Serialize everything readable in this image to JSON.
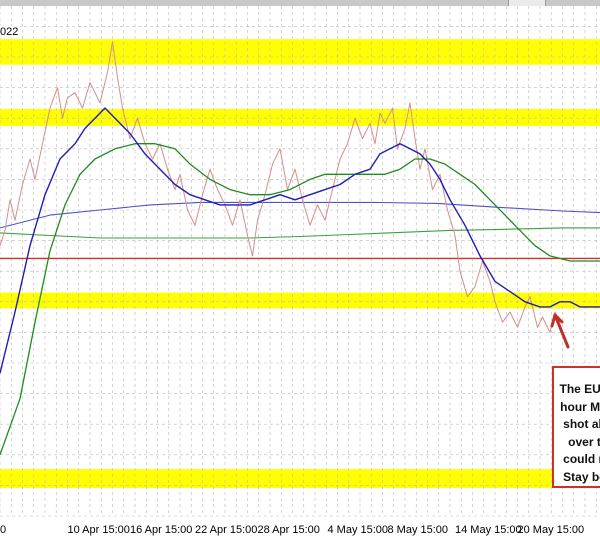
{
  "date_fragment": "022",
  "annotation_lines": [
    "The EUR",
    "hour MA",
    "shot ab",
    "over t",
    "could n",
    "Stay be"
  ],
  "colors": {
    "background": "#ffffff",
    "grid": "#b9b9b9",
    "highlight": "#ffff00",
    "price": "#d88c8c",
    "ma_blue": "#1e1eb4",
    "ma_green": "#1e8c1e",
    "ma_long_blue": "#5050c8",
    "ma_long_green": "#3ca03c",
    "red_level": "#d0302a",
    "annotation_border": "#d0302a",
    "arrow": "#c0302a"
  },
  "chart_data": {
    "type": "line",
    "title": "",
    "xlabel": "",
    "ylabel": "",
    "x_tick_labels": [
      "0",
      "10 Apr 15:00",
      "16 Apr 15:00",
      "22 Apr 15:00",
      "28 Apr 15:00",
      "4 May 15:00",
      "8 May 15:00",
      "14 May 15:00",
      "20 May 15:00"
    ],
    "x_ticks": [
      0,
      27,
      52,
      78,
      103,
      131,
      155,
      182,
      207
    ],
    "xlim": [
      0,
      240
    ],
    "ylim": [
      0,
      100
    ],
    "highlight_zones": [
      [
        88.5,
        93.5
      ],
      [
        76.5,
        79.8
      ],
      [
        40.7,
        43.8
      ],
      [
        5.5,
        9.2
      ]
    ],
    "horizontal_levels": [
      {
        "name": "red",
        "value": 50.5
      }
    ],
    "series": [
      {
        "key": "price",
        "points": [
          [
            0,
            53
          ],
          [
            2,
            56
          ],
          [
            4,
            62
          ],
          [
            6,
            58
          ],
          [
            9,
            65
          ],
          [
            12,
            70
          ],
          [
            14,
            66
          ],
          [
            17,
            73
          ],
          [
            20,
            80
          ],
          [
            23,
            84
          ],
          [
            25,
            78
          ],
          [
            27,
            82
          ],
          [
            30,
            83
          ],
          [
            33,
            80
          ],
          [
            36,
            85
          ],
          [
            38,
            83
          ],
          [
            40,
            81
          ],
          [
            43,
            87
          ],
          [
            45,
            93
          ],
          [
            47,
            86
          ],
          [
            49,
            80
          ],
          [
            52,
            74
          ],
          [
            55,
            78
          ],
          [
            58,
            73
          ],
          [
            61,
            70
          ],
          [
            64,
            73
          ],
          [
            67,
            68
          ],
          [
            70,
            64
          ],
          [
            72,
            67
          ],
          [
            75,
            60
          ],
          [
            78,
            57
          ],
          [
            81,
            63
          ],
          [
            84,
            68
          ],
          [
            87,
            64
          ],
          [
            90,
            61
          ],
          [
            93,
            57
          ],
          [
            96,
            62
          ],
          [
            99,
            55
          ],
          [
            101,
            51
          ],
          [
            103,
            58
          ],
          [
            106,
            63
          ],
          [
            109,
            69
          ],
          [
            112,
            72
          ],
          [
            115,
            64
          ],
          [
            118,
            68
          ],
          [
            121,
            62
          ],
          [
            124,
            57
          ],
          [
            127,
            61
          ],
          [
            130,
            58
          ],
          [
            133,
            64
          ],
          [
            136,
            70
          ],
          [
            139,
            73
          ],
          [
            142,
            78
          ],
          [
            145,
            74
          ],
          [
            148,
            77
          ],
          [
            150,
            73
          ],
          [
            152,
            79
          ],
          [
            154,
            77
          ],
          [
            157,
            80
          ],
          [
            159,
            72
          ],
          [
            162,
            76
          ],
          [
            164,
            81
          ],
          [
            166,
            74
          ],
          [
            168,
            68
          ],
          [
            170,
            72
          ],
          [
            173,
            64
          ],
          [
            176,
            67
          ],
          [
            179,
            60
          ],
          [
            182,
            55
          ],
          [
            184,
            48
          ],
          [
            187,
            43
          ],
          [
            190,
            45
          ],
          [
            193,
            50
          ],
          [
            196,
            46
          ],
          [
            198,
            42
          ],
          [
            201,
            38
          ],
          [
            204,
            40
          ],
          [
            207,
            37
          ],
          [
            210,
            41
          ],
          [
            212,
            43
          ],
          [
            215,
            37
          ],
          [
            217,
            39
          ],
          [
            220,
            36
          ],
          [
            222,
            40
          ],
          [
            224,
            38
          ]
        ]
      },
      {
        "key": "ma_blue",
        "points": [
          [
            0,
            28
          ],
          [
            6,
            40
          ],
          [
            12,
            53
          ],
          [
            18,
            63
          ],
          [
            24,
            70
          ],
          [
            30,
            73
          ],
          [
            34,
            76
          ],
          [
            38,
            78
          ],
          [
            42,
            80
          ],
          [
            46,
            78
          ],
          [
            52,
            75
          ],
          [
            58,
            71
          ],
          [
            64,
            68
          ],
          [
            70,
            65
          ],
          [
            76,
            63
          ],
          [
            82,
            62
          ],
          [
            88,
            61
          ],
          [
            94,
            61
          ],
          [
            100,
            61
          ],
          [
            106,
            62
          ],
          [
            112,
            63
          ],
          [
            118,
            62
          ],
          [
            124,
            63
          ],
          [
            130,
            64
          ],
          [
            136,
            65
          ],
          [
            142,
            67
          ],
          [
            148,
            68
          ],
          [
            152,
            71
          ],
          [
            156,
            72
          ],
          [
            160,
            73
          ],
          [
            164,
            72
          ],
          [
            168,
            71
          ],
          [
            172,
            69
          ],
          [
            176,
            66
          ],
          [
            180,
            62
          ],
          [
            186,
            57
          ],
          [
            192,
            51
          ],
          [
            198,
            46
          ],
          [
            204,
            44
          ],
          [
            210,
            42
          ],
          [
            216,
            41
          ],
          [
            220,
            41
          ],
          [
            224,
            42
          ],
          [
            228,
            42
          ],
          [
            232,
            41
          ],
          [
            240,
            41
          ]
        ]
      },
      {
        "key": "ma_green",
        "points": [
          [
            0,
            12
          ],
          [
            8,
            23
          ],
          [
            14,
            38
          ],
          [
            20,
            52
          ],
          [
            26,
            61
          ],
          [
            32,
            67
          ],
          [
            38,
            70
          ],
          [
            46,
            72
          ],
          [
            54,
            73
          ],
          [
            62,
            73
          ],
          [
            70,
            72
          ],
          [
            76,
            69
          ],
          [
            84,
            66
          ],
          [
            92,
            64
          ],
          [
            100,
            63
          ],
          [
            108,
            63
          ],
          [
            116,
            64
          ],
          [
            124,
            66
          ],
          [
            130,
            67
          ],
          [
            136,
            67
          ],
          [
            142,
            67
          ],
          [
            148,
            67
          ],
          [
            154,
            67
          ],
          [
            160,
            68
          ],
          [
            166,
            70
          ],
          [
            172,
            70
          ],
          [
            178,
            69
          ],
          [
            184,
            67
          ],
          [
            190,
            65
          ],
          [
            196,
            62
          ],
          [
            202,
            59
          ],
          [
            208,
            56
          ],
          [
            214,
            53
          ],
          [
            220,
            51
          ],
          [
            228,
            50
          ],
          [
            240,
            50
          ]
        ]
      },
      {
        "key": "ma_long_blue",
        "points": [
          [
            0,
            56.5
          ],
          [
            20,
            59
          ],
          [
            40,
            60
          ],
          [
            60,
            61
          ],
          [
            80,
            61.5
          ],
          [
            100,
            61.5
          ],
          [
            120,
            61.5
          ],
          [
            150,
            61.5
          ],
          [
            175,
            61.3
          ],
          [
            200,
            60.5
          ],
          [
            225,
            59.8
          ],
          [
            240,
            59.5
          ]
        ]
      },
      {
        "key": "ma_long_green",
        "points": [
          [
            0,
            55.5
          ],
          [
            20,
            55
          ],
          [
            40,
            54.5
          ],
          [
            60,
            54.5
          ],
          [
            80,
            54.5
          ],
          [
            100,
            54.5
          ],
          [
            120,
            54.8
          ],
          [
            140,
            55.2
          ],
          [
            160,
            55.6
          ],
          [
            180,
            56
          ],
          [
            200,
            56.2
          ],
          [
            225,
            56.5
          ],
          [
            240,
            56.5
          ]
        ]
      }
    ]
  }
}
